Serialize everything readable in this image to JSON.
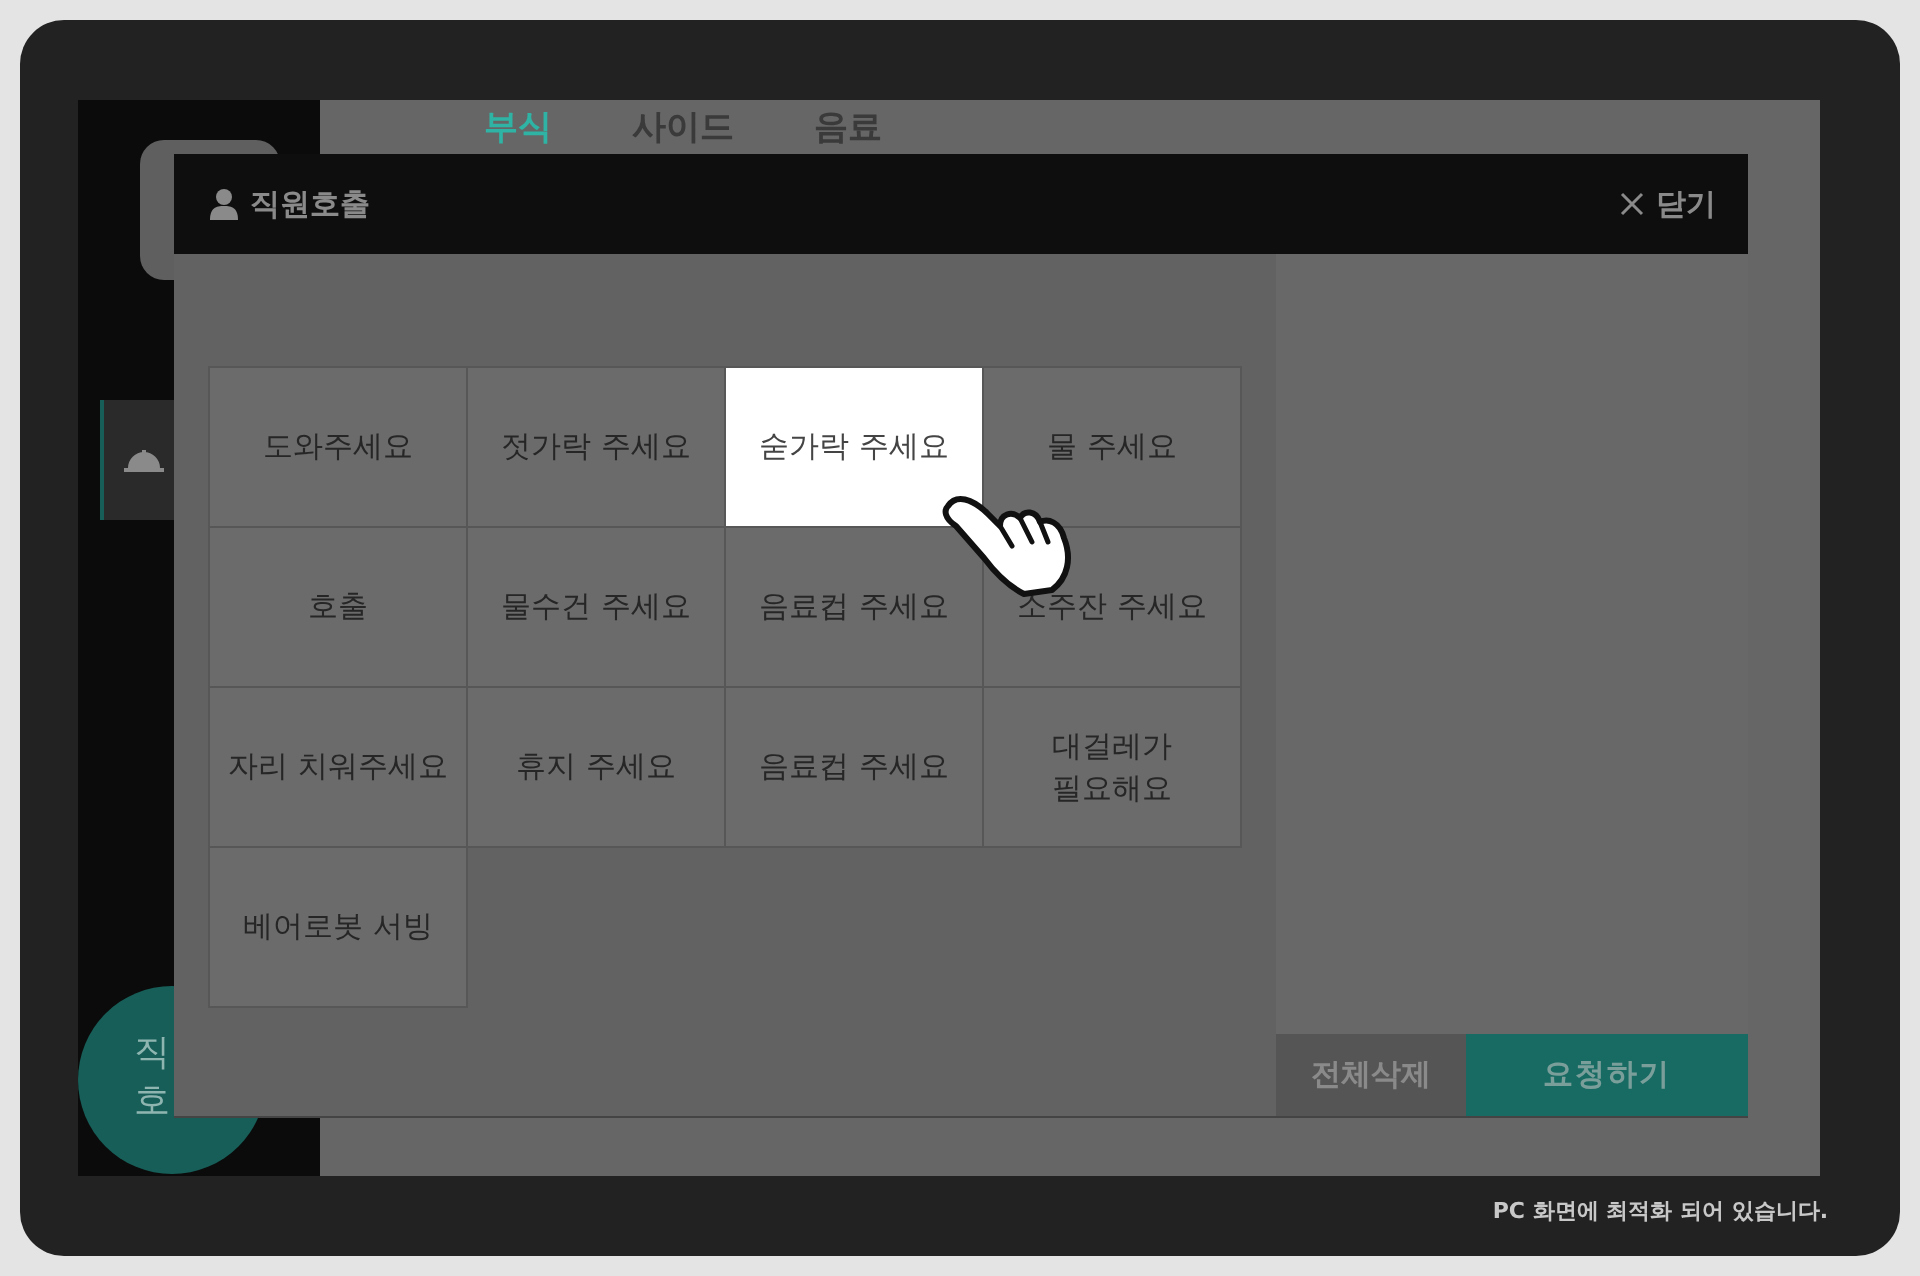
{
  "tabs": [
    {
      "label": "부식",
      "selected": true
    },
    {
      "label": "사이드",
      "selected": false
    },
    {
      "label": "음료",
      "selected": false
    }
  ],
  "floating_button": {
    "label": "직\n호"
  },
  "modal": {
    "title": "직원호출",
    "close": "닫기",
    "options": [
      {
        "label": "도와주세요",
        "selected": false
      },
      {
        "label": "젓가락 주세요",
        "selected": false
      },
      {
        "label": "숟가락 주세요",
        "selected": true
      },
      {
        "label": "물 주세요",
        "selected": false
      },
      {
        "label": "호출",
        "selected": false
      },
      {
        "label": "물수건 주세요",
        "selected": false
      },
      {
        "label": "음료컵 주세요",
        "selected": false
      },
      {
        "label": "소주잔 주세요",
        "selected": false
      },
      {
        "label": "자리 치워주세요",
        "selected": false
      },
      {
        "label": "휴지 주세요",
        "selected": false
      },
      {
        "label": "음료컵 주세요",
        "selected": false
      },
      {
        "label": "대걸레가\n필요해요",
        "selected": false
      },
      {
        "label": "베어로봇 서빙",
        "selected": false
      }
    ],
    "buttons": [
      {
        "label": "전체삭제",
        "kind": "clear"
      },
      {
        "label": "요청하기",
        "kind": "submit"
      }
    ]
  },
  "footer": "PC 화면에 최적화 되어 있습니다."
}
